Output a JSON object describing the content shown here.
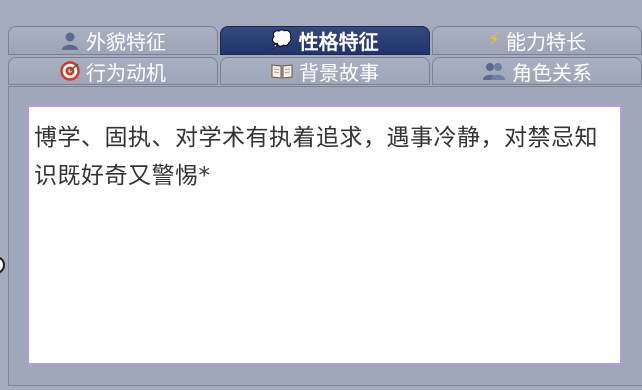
{
  "tabs_row1": [
    {
      "label": "外貌特征",
      "icon": "person-silhouette-icon",
      "active": false
    },
    {
      "label": "性格特征",
      "icon": "thought-bubble-icon",
      "active": true
    },
    {
      "label": "能力特长",
      "icon": "lightning-icon",
      "active": false
    }
  ],
  "tabs_row2": [
    {
      "label": "行为动机",
      "icon": "target-icon",
      "active": false
    },
    {
      "label": "背景故事",
      "icon": "open-book-icon",
      "active": false
    },
    {
      "label": "角色关系",
      "icon": "two-people-icon",
      "active": false
    }
  ],
  "glyphs": {
    "thought": "💭",
    "lightning": "⚡"
  },
  "editor": {
    "content": "博学、固执、对学术有执着追求，遇事冷静，对禁忌知识既好奇又警惕*"
  },
  "colors": {
    "active_tab": "#22346a",
    "inactive_tab": "#a4abbd",
    "editor_border": "#b49be0",
    "text": "#333333"
  }
}
